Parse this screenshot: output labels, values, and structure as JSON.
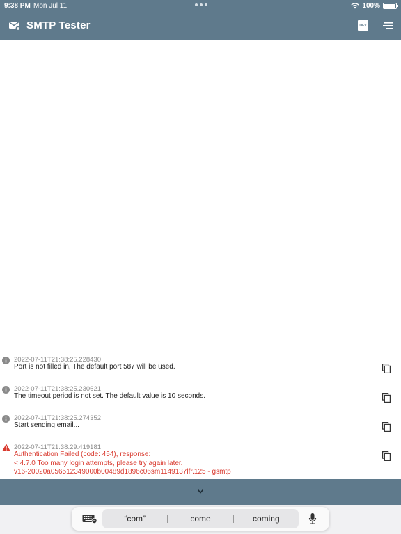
{
  "status_bar": {
    "time": "9:38 PM",
    "date": "Mon Jul 11",
    "battery": "100%"
  },
  "header": {
    "title": "SMTP Tester",
    "dev_badge": "DEV",
    "app_icon": "mail-plus-icon",
    "menu_icon": "sort-menu-icon"
  },
  "logs": [
    {
      "level": "info",
      "timestamp": "2022-07-11T21:38:25.228430",
      "lines": [
        "Port is not filled in, The default port 587 will be used."
      ]
    },
    {
      "level": "info",
      "timestamp": "2022-07-11T21:38:25.230621",
      "lines": [
        "The timeout period is not set. The default value is 10 seconds."
      ]
    },
    {
      "level": "info",
      "timestamp": "2022-07-11T21:38:25.274352",
      "lines": [
        "Start sending email..."
      ]
    },
    {
      "level": "error",
      "timestamp": "2022-07-11T21:38:29.419181",
      "lines": [
        "Authentication Failed (code: 454), response:",
        "< 4.7.0 Too many login attempts, please try again later.",
        "v16-20020a056512349000b00489d1896c06sm1149137lfr.125 - gsmtp"
      ]
    }
  ],
  "keyboard": {
    "suggestions": [
      "“com”",
      "come",
      "coming"
    ]
  },
  "colors": {
    "header_bg": "#5f7a8c",
    "info_icon": "#8a8a8a",
    "error": "#d93a2f"
  }
}
